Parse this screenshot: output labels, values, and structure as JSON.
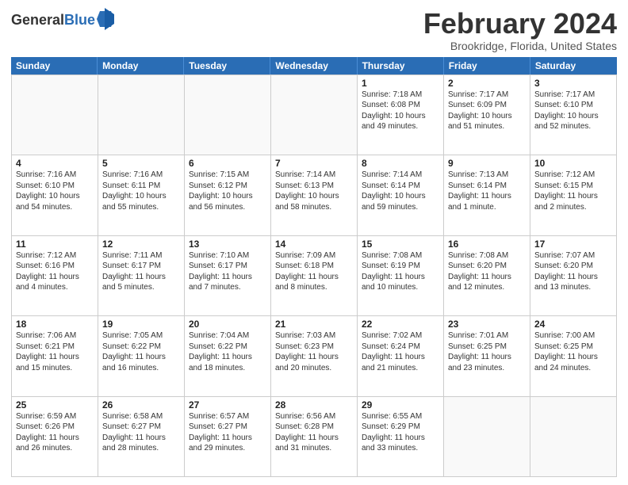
{
  "header": {
    "logo_general": "General",
    "logo_blue": "Blue",
    "month_title": "February 2024",
    "location": "Brookridge, Florida, United States"
  },
  "weekdays": [
    "Sunday",
    "Monday",
    "Tuesday",
    "Wednesday",
    "Thursday",
    "Friday",
    "Saturday"
  ],
  "weeks": [
    [
      {
        "day": "",
        "info": ""
      },
      {
        "day": "",
        "info": ""
      },
      {
        "day": "",
        "info": ""
      },
      {
        "day": "",
        "info": ""
      },
      {
        "day": "1",
        "info": "Sunrise: 7:18 AM\nSunset: 6:08 PM\nDaylight: 10 hours\nand 49 minutes."
      },
      {
        "day": "2",
        "info": "Sunrise: 7:17 AM\nSunset: 6:09 PM\nDaylight: 10 hours\nand 51 minutes."
      },
      {
        "day": "3",
        "info": "Sunrise: 7:17 AM\nSunset: 6:10 PM\nDaylight: 10 hours\nand 52 minutes."
      }
    ],
    [
      {
        "day": "4",
        "info": "Sunrise: 7:16 AM\nSunset: 6:10 PM\nDaylight: 10 hours\nand 54 minutes."
      },
      {
        "day": "5",
        "info": "Sunrise: 7:16 AM\nSunset: 6:11 PM\nDaylight: 10 hours\nand 55 minutes."
      },
      {
        "day": "6",
        "info": "Sunrise: 7:15 AM\nSunset: 6:12 PM\nDaylight: 10 hours\nand 56 minutes."
      },
      {
        "day": "7",
        "info": "Sunrise: 7:14 AM\nSunset: 6:13 PM\nDaylight: 10 hours\nand 58 minutes."
      },
      {
        "day": "8",
        "info": "Sunrise: 7:14 AM\nSunset: 6:14 PM\nDaylight: 10 hours\nand 59 minutes."
      },
      {
        "day": "9",
        "info": "Sunrise: 7:13 AM\nSunset: 6:14 PM\nDaylight: 11 hours\nand 1 minute."
      },
      {
        "day": "10",
        "info": "Sunrise: 7:12 AM\nSunset: 6:15 PM\nDaylight: 11 hours\nand 2 minutes."
      }
    ],
    [
      {
        "day": "11",
        "info": "Sunrise: 7:12 AM\nSunset: 6:16 PM\nDaylight: 11 hours\nand 4 minutes."
      },
      {
        "day": "12",
        "info": "Sunrise: 7:11 AM\nSunset: 6:17 PM\nDaylight: 11 hours\nand 5 minutes."
      },
      {
        "day": "13",
        "info": "Sunrise: 7:10 AM\nSunset: 6:17 PM\nDaylight: 11 hours\nand 7 minutes."
      },
      {
        "day": "14",
        "info": "Sunrise: 7:09 AM\nSunset: 6:18 PM\nDaylight: 11 hours\nand 8 minutes."
      },
      {
        "day": "15",
        "info": "Sunrise: 7:08 AM\nSunset: 6:19 PM\nDaylight: 11 hours\nand 10 minutes."
      },
      {
        "day": "16",
        "info": "Sunrise: 7:08 AM\nSunset: 6:20 PM\nDaylight: 11 hours\nand 12 minutes."
      },
      {
        "day": "17",
        "info": "Sunrise: 7:07 AM\nSunset: 6:20 PM\nDaylight: 11 hours\nand 13 minutes."
      }
    ],
    [
      {
        "day": "18",
        "info": "Sunrise: 7:06 AM\nSunset: 6:21 PM\nDaylight: 11 hours\nand 15 minutes."
      },
      {
        "day": "19",
        "info": "Sunrise: 7:05 AM\nSunset: 6:22 PM\nDaylight: 11 hours\nand 16 minutes."
      },
      {
        "day": "20",
        "info": "Sunrise: 7:04 AM\nSunset: 6:22 PM\nDaylight: 11 hours\nand 18 minutes."
      },
      {
        "day": "21",
        "info": "Sunrise: 7:03 AM\nSunset: 6:23 PM\nDaylight: 11 hours\nand 20 minutes."
      },
      {
        "day": "22",
        "info": "Sunrise: 7:02 AM\nSunset: 6:24 PM\nDaylight: 11 hours\nand 21 minutes."
      },
      {
        "day": "23",
        "info": "Sunrise: 7:01 AM\nSunset: 6:25 PM\nDaylight: 11 hours\nand 23 minutes."
      },
      {
        "day": "24",
        "info": "Sunrise: 7:00 AM\nSunset: 6:25 PM\nDaylight: 11 hours\nand 24 minutes."
      }
    ],
    [
      {
        "day": "25",
        "info": "Sunrise: 6:59 AM\nSunset: 6:26 PM\nDaylight: 11 hours\nand 26 minutes."
      },
      {
        "day": "26",
        "info": "Sunrise: 6:58 AM\nSunset: 6:27 PM\nDaylight: 11 hours\nand 28 minutes."
      },
      {
        "day": "27",
        "info": "Sunrise: 6:57 AM\nSunset: 6:27 PM\nDaylight: 11 hours\nand 29 minutes."
      },
      {
        "day": "28",
        "info": "Sunrise: 6:56 AM\nSunset: 6:28 PM\nDaylight: 11 hours\nand 31 minutes."
      },
      {
        "day": "29",
        "info": "Sunrise: 6:55 AM\nSunset: 6:29 PM\nDaylight: 11 hours\nand 33 minutes."
      },
      {
        "day": "",
        "info": ""
      },
      {
        "day": "",
        "info": ""
      }
    ]
  ]
}
